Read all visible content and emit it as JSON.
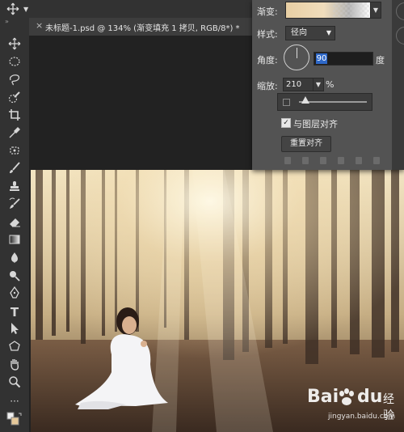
{
  "options_bar": {
    "move_icon": "move-arrows-icon"
  },
  "document": {
    "tab_title": "未标题-1.psd @ 134% (渐变填充 1 拷贝, RGB/8*) *",
    "close_glyph": "×"
  },
  "toolbar": {
    "collapse_glyph": "»",
    "tools": [
      "move-tool-icon",
      "marquee-tool-icon",
      "lasso-tool-icon",
      "quick-select-tool-icon",
      "crop-tool-icon",
      "eyedropper-tool-icon",
      "patch-tool-icon",
      "brush-tool-icon",
      "stamp-tool-icon",
      "history-brush-icon",
      "eraser-tool-icon",
      "gradient-tool-icon",
      "blur-tool-icon",
      "dodge-tool-icon",
      "pen-tool-icon",
      "type-tool-icon",
      "path-select-tool-icon",
      "shape-tool-icon",
      "hand-tool-icon",
      "zoom-tool-icon",
      "more-tools-icon",
      "color-swatches-icon"
    ],
    "type_glyph": "T",
    "more_glyph": "···"
  },
  "gradient_dialog": {
    "gradient_label": "渐变:",
    "style_label": "样式:",
    "style_value": "径向",
    "angle_label": "角度:",
    "angle_value": "90",
    "angle_unit": "度",
    "scale_label": "缩放:",
    "scale_value": "210",
    "scale_unit": "%",
    "align_label": "与图层对齐",
    "align_checked": true,
    "reset_label": "重置对齐",
    "slider_level": 0.1
  },
  "watermark": {
    "brand_pre": "Bai",
    "brand_post": "du",
    "brand_suffix": "经验",
    "url": "jingyan.baidu.com"
  },
  "colors": {
    "panel": "#535353",
    "toolbar": "#323232",
    "selection": "#2e68c8"
  }
}
